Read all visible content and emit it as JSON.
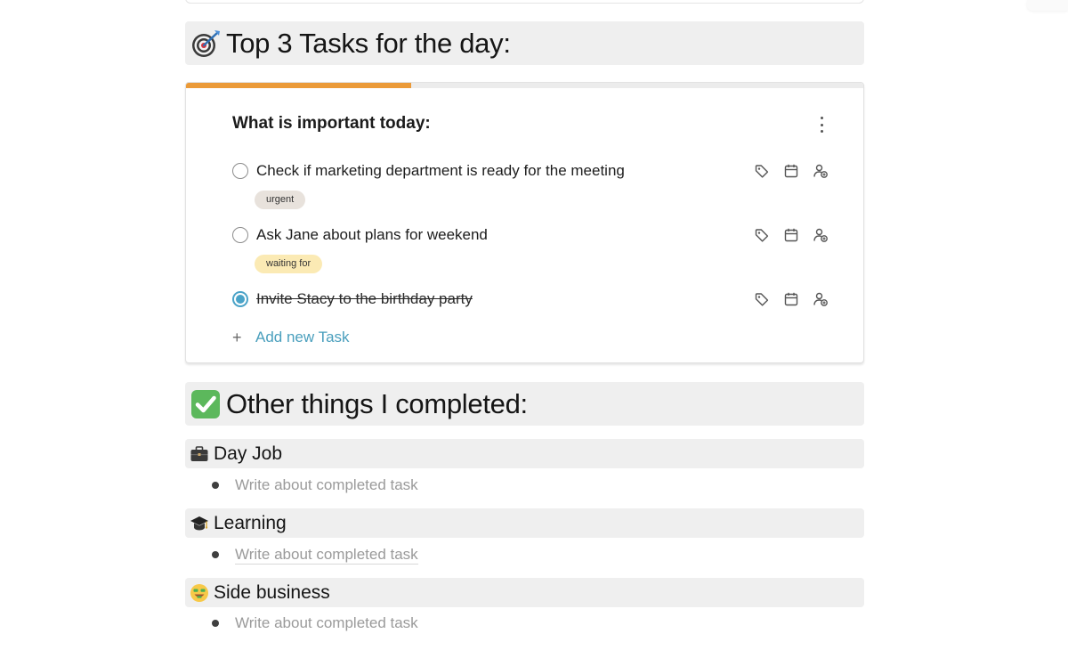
{
  "sections": {
    "top_tasks_heading": "Top 3 Tasks for the day:",
    "completed_heading": "Other things I completed:"
  },
  "task_widget": {
    "title": "What is important today:",
    "progress_fraction": 0.333,
    "progress_color": "#eb9a38",
    "tasks": [
      {
        "text": "Check if marketing department is ready for the meeting",
        "done": false,
        "tag": "urgent",
        "tag_color": "#e8e2dc"
      },
      {
        "text": "Ask Jane about plans for weekend",
        "done": false,
        "tag": "waiting for",
        "tag_color": "#fbeab4"
      },
      {
        "text": "Invite Stacy to the birthday party",
        "done": true,
        "tag": "",
        "tag_color": ""
      }
    ],
    "add_task_label": "Add new Task",
    "add_task_plus": "+",
    "row_icons": [
      "tag-icon",
      "calendar-icon",
      "assign-user-icon"
    ]
  },
  "categories": [
    {
      "title": "Day Job",
      "emoji": "briefcase",
      "placeholder": "Write about completed task"
    },
    {
      "title": "Learning",
      "emoji": "graduation-cap",
      "placeholder": "Write about completed task"
    },
    {
      "title": "Side business",
      "emoji": "money-mouth-face",
      "placeholder": "Write about completed task"
    }
  ]
}
